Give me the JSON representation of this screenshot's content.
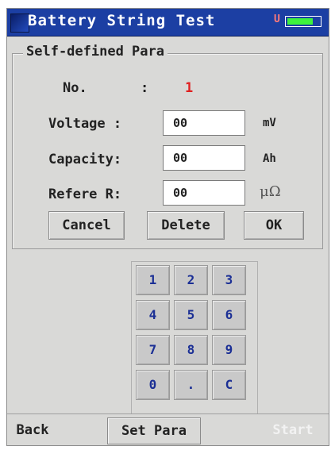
{
  "title": "Battery String Test",
  "status": {
    "indicator": "U",
    "battery_icon": "battery-icon",
    "battery_level": 0.8,
    "battery_color": "#3df23d"
  },
  "panel": {
    "title": "Self-defined Para",
    "no": {
      "label": "No.",
      "sep": ":",
      "value": "1"
    },
    "voltage": {
      "label": "Voltage :",
      "value": "00",
      "unit": "mV"
    },
    "capacity": {
      "label": "Capacity:",
      "value": "00",
      "unit": "Ah"
    },
    "refere_r": {
      "label": "Refere R:",
      "value": "00",
      "unit": "μΩ"
    },
    "buttons": {
      "cancel": "Cancel",
      "delete": "Delete",
      "ok": "OK"
    }
  },
  "keypad": {
    "keys": [
      "1",
      "2",
      "3",
      "4",
      "5",
      "6",
      "7",
      "8",
      "9",
      "0",
      ".",
      "C"
    ]
  },
  "bottom_bar": {
    "back": "Back",
    "set_para": "Set Para",
    "start": "Start"
  },
  "colors": {
    "title_bar": "#1c3fa3",
    "accent_red": "#e02020",
    "keypad_text": "#1b2f95"
  }
}
